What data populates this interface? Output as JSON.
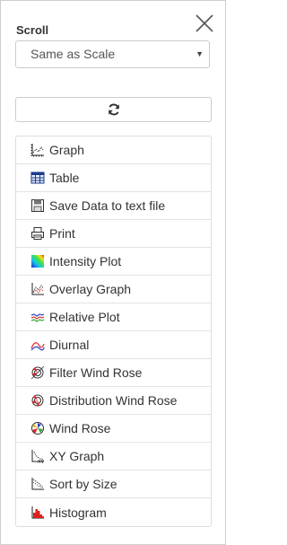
{
  "scroll": {
    "label": "Scroll",
    "selected": "Same as Scale"
  },
  "menu": {
    "items": [
      {
        "label": "Graph",
        "icon": "line-graph-icon"
      },
      {
        "label": "Table",
        "icon": "table-icon"
      },
      {
        "label": "Save Data to text file",
        "icon": "floppy-disk-icon"
      },
      {
        "label": "Print",
        "icon": "printer-icon"
      },
      {
        "label": "Intensity Plot",
        "icon": "intensity-plot-icon"
      },
      {
        "label": "Overlay Graph",
        "icon": "overlay-graph-icon"
      },
      {
        "label": "Relative Plot",
        "icon": "relative-plot-icon"
      },
      {
        "label": "Diurnal",
        "icon": "diurnal-icon"
      },
      {
        "label": "Filter Wind Rose",
        "icon": "filter-wind-rose-icon"
      },
      {
        "label": "Distribution Wind Rose",
        "icon": "distribution-wind-rose-icon"
      },
      {
        "label": "Wind Rose",
        "icon": "wind-rose-icon"
      },
      {
        "label": "XY Graph",
        "icon": "xy-graph-icon"
      },
      {
        "label": "Sort by Size",
        "icon": "sort-by-size-icon"
      },
      {
        "label": "Histogram",
        "icon": "histogram-icon"
      }
    ]
  }
}
